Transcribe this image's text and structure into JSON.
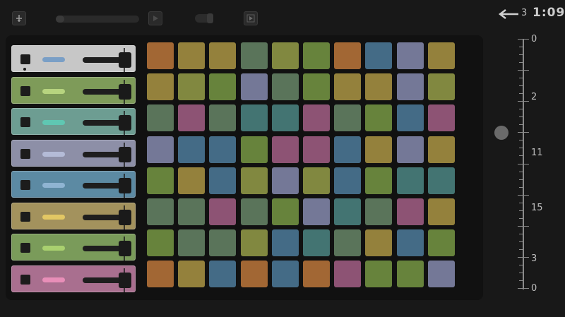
{
  "toolbar": {
    "icons": [
      "tune-fork-icon",
      "play-icon",
      "record-toggle-icon",
      "export-icon"
    ],
    "slider_value": 0.1
  },
  "tracks": [
    {
      "color": "#c7c7c7",
      "pill": "#7a9fc6",
      "volume": 0.75
    },
    {
      "color": "#7e9b59",
      "pill": "#b7d47f",
      "volume": 0.75
    },
    {
      "color": "#6d9d92",
      "pill": "#5fc7b2",
      "volume": 0.75
    },
    {
      "color": "#8d8fa7",
      "pill": "#b4bbd7",
      "volume": 0.75
    },
    {
      "color": "#5c8aa3",
      "pill": "#8fb4d2",
      "volume": 0.75
    },
    {
      "color": "#a3925d",
      "pill": "#e2c764",
      "volume": 0.75
    },
    {
      "color": "#7a9b5a",
      "pill": "#a9d06f",
      "volume": 0.75
    },
    {
      "color": "#a96f8f",
      "pill": "#e88eb8",
      "volume": 0.75
    }
  ],
  "pad_palette": {
    "O": "#c27a3c",
    "Y": "#b19a45",
    "G": "#7a9c46",
    "T": "#4e8a88",
    "B": "#4f7fa0",
    "P": "#8a8fb5",
    "M": "#a8618a",
    "L": "#9aa24a",
    "S": "#6a8a6a"
  },
  "pad_grid": [
    [
      "O",
      "Y",
      "Y",
      "S",
      "L",
      "G",
      "O",
      "B",
      "P",
      "Y"
    ],
    [
      "Y",
      "L",
      "G",
      "P",
      "S",
      "G",
      "Y",
      "Y",
      "P",
      "L"
    ],
    [
      "S",
      "M",
      "S",
      "T",
      "T",
      "M",
      "S",
      "G",
      "B",
      "M"
    ],
    [
      "P",
      "B",
      "B",
      "G",
      "M",
      "M",
      "B",
      "Y",
      "P",
      "Y"
    ],
    [
      "G",
      "Y",
      "B",
      "L",
      "P",
      "L",
      "B",
      "G",
      "T",
      "T"
    ],
    [
      "S",
      "S",
      "M",
      "S",
      "G",
      "P",
      "T",
      "S",
      "M",
      "Y"
    ],
    [
      "G",
      "S",
      "S",
      "L",
      "B",
      "T",
      "S",
      "Y",
      "B",
      "G"
    ],
    [
      "O",
      "Y",
      "B",
      "O",
      "B",
      "O",
      "M",
      "G",
      "G",
      "P"
    ]
  ],
  "header": {
    "beat_number": "3",
    "time": "1:09"
  },
  "ruler": {
    "labels": [
      "0",
      "2",
      "11",
      "15",
      "3",
      "0"
    ]
  }
}
